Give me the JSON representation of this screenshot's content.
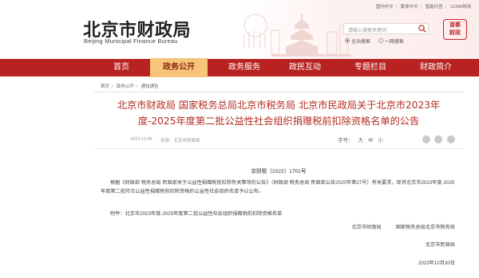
{
  "header": {
    "site_title": "北京市财政局",
    "site_subtitle": "Beijing Municipal Finance Bureau",
    "top_links": [
      "国内中文",
      "繁体中文",
      "智能问答",
      "12345热线"
    ],
    "search_placeholder": "请输入搜索关键词",
    "search_scope": [
      "全站搜索",
      "一网搜索"
    ],
    "logo_text": [
      "首都",
      "财政"
    ]
  },
  "nav": {
    "items": [
      "首页",
      "政务公开",
      "政务服务",
      "政民互动",
      "专题栏目",
      "财政简介"
    ],
    "active_index": 1
  },
  "breadcrumb": [
    "首页",
    "政务公开",
    "通知通告"
  ],
  "article": {
    "title_line1": "北京市财政局 国家税务总局北京市税务局 北京市民政局关于北京市2023年",
    "title_line2": "度-2025年度第二批公益性社会组织捐赠税前扣除资格名单的公告",
    "date": "2023-11-06",
    "source": "来源：北京市财政局",
    "font_size_label": "字号：",
    "font_sizes": [
      "大",
      "中",
      "小"
    ],
    "doc_number": "京财税〔2023〕1701号",
    "paragraph": "根据《财政部 税务总局 民政部关于公益性捐赠税前扣除有关事项的公告》（财政部 税务总局 民政部公告2020年第27号）有关要求，现将北京市2023年度-2025年度第二批符合公益性捐赠税前扣除资格的公益性社会组织名单予以公布。",
    "attachment": "附件：北京市2023年度-2025年度第二批公益性社会组织捐赠税前扣除资格名单",
    "signatory1": "北京市财政局",
    "signatory2": "国家税务总局北京市税务局",
    "signatory3": "北京市民政局",
    "sign_date": "2023年10月30日"
  },
  "colors": {
    "nav_bg": "#b82220",
    "nav_active_bg": "#f6c57b",
    "title_red": "#b52c22"
  }
}
